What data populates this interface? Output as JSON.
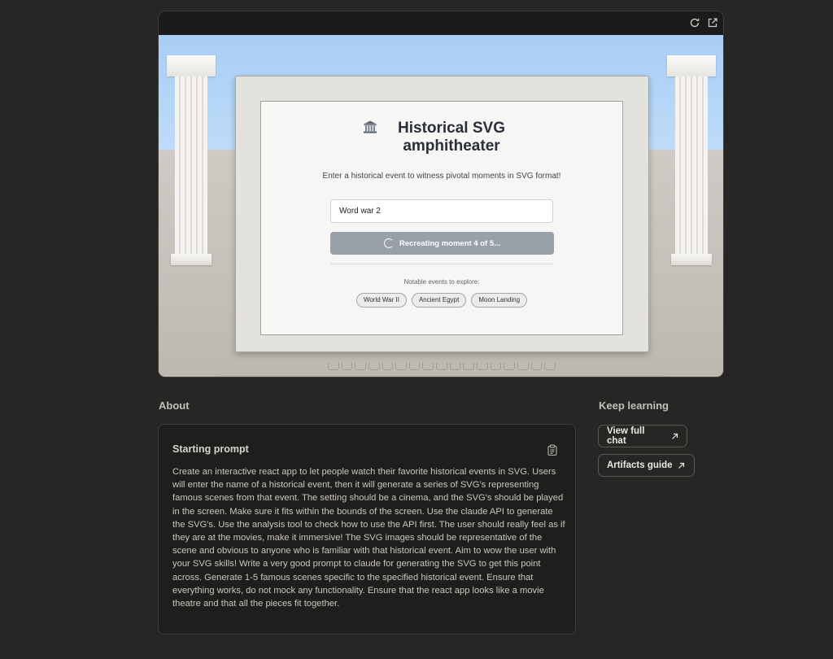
{
  "artifact": {
    "app_title": "Historical SVG amphitheater",
    "subtitle": "Enter a historical event to witness pivotal moments in SVG format!",
    "input_value": "Word war 2",
    "button_label": "Recreating moment 4 of 5...",
    "notable_label": "Notable events to explore:",
    "chips": [
      "World War II",
      "Ancient Egypt",
      "Moon Landing"
    ],
    "icons": [
      "refresh-icon",
      "open-external-icon",
      "classical-building-icon",
      "spinner-icon"
    ]
  },
  "about": {
    "heading": "About",
    "prompt_title": "Starting prompt",
    "prompt_text": "Create an interactive react app to let people watch their favorite historical events in SVG. Users will enter the name of a historical event, then it will generate a series of SVG's representing famous scenes from that event. The setting should be a cinema, and the SVG's should be played in the screen. Make sure it fits within the bounds of the screen. Use the claude API to generate the SVG's. Use the analysis tool to check how to use the API first. The user should really feel as if they are at the movies, make it immersive! The SVG images should be representative of the scene and obvious to anyone who is familiar with that historical event. Aim to wow the user with your SVG skills! Write a very good prompt to claude for generating the SVG to get this point across. Generate 1-5 famous scenes specific to the specified historical event. Ensure that everything works, do not mock any functionality. Ensure that the react app looks like a movie theatre and that all the pieces fit together."
  },
  "keep_learning": {
    "heading": "Keep learning",
    "view_full_chat": "View full chat",
    "artifacts_guide": "Artifacts guide"
  }
}
